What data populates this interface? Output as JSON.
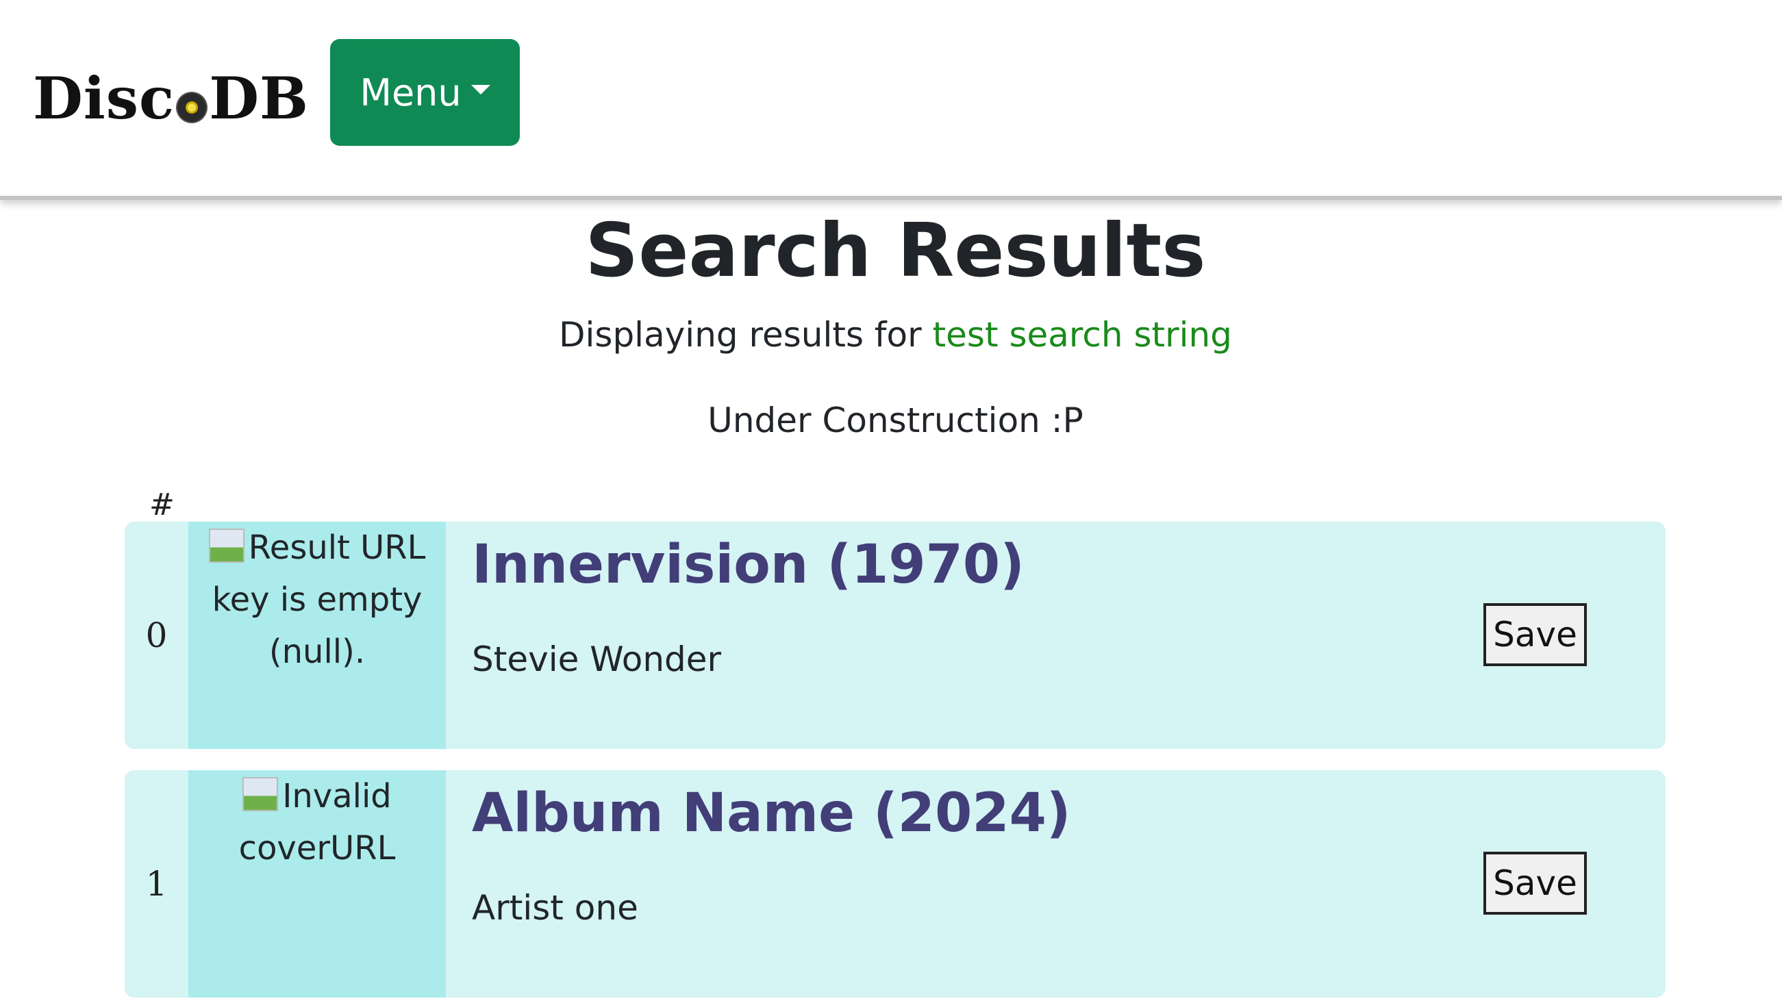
{
  "header": {
    "logo_left": "Disc",
    "logo_right": "DB",
    "menu_label": "Menu"
  },
  "page": {
    "title": "Search Results",
    "subtitle_prefix": "Displaying results for ",
    "query": "test search string",
    "notice": "Under Construction :P"
  },
  "table": {
    "index_header": "#",
    "results": [
      {
        "index": "0",
        "cover_alt": "Result URL key is empty (null).",
        "album": "Innervision (1970)",
        "artist": "Stevie Wonder",
        "save_label": "Save"
      },
      {
        "index": "1",
        "cover_alt": "Invalid coverURL",
        "album": "Album Name (2024)",
        "artist": "Artist one",
        "save_label": "Save"
      }
    ]
  },
  "colors": {
    "menu_button": "#0f8a54",
    "query_text": "#1a8a1a",
    "row_background": "#d5f4f4",
    "cover_background": "#abebeb",
    "album_title": "#423e78"
  }
}
